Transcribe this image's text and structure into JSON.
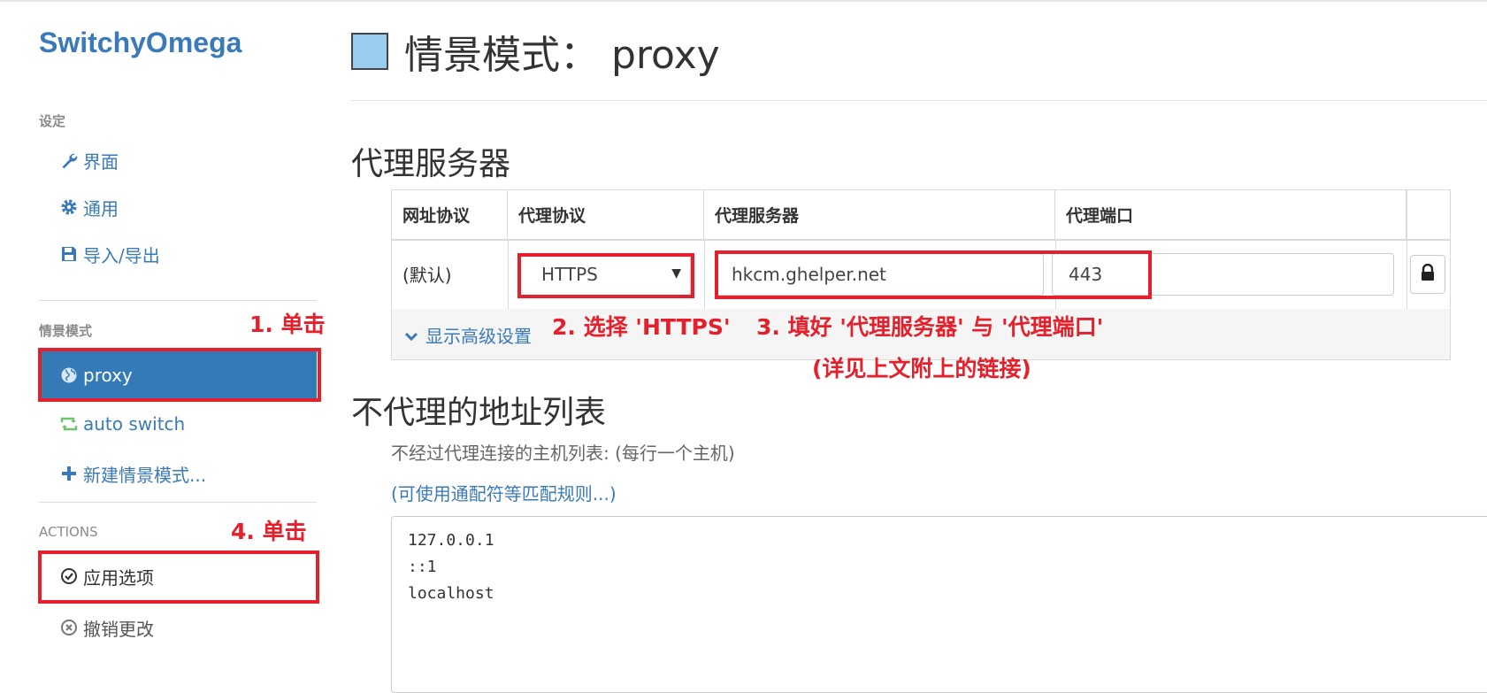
{
  "app": {
    "brand": "SwitchyOmega"
  },
  "sidebar": {
    "settings_heading": "设定",
    "settings_items": [
      {
        "label": "界面",
        "icon": "wrench-icon"
      },
      {
        "label": "通用",
        "icon": "gear-icon"
      },
      {
        "label": "导入/导出",
        "icon": "floppy-icon"
      }
    ],
    "profiles_heading": "情景模式",
    "profiles": [
      {
        "label": "proxy",
        "icon": "globe-icon",
        "active": true
      },
      {
        "label": "auto switch",
        "icon": "retweet-icon",
        "active": false
      },
      {
        "label": "新建情景模式...",
        "icon": "plus-icon",
        "active": false
      }
    ],
    "actions_heading": "ACTIONS",
    "actions": [
      {
        "label": "应用选项",
        "icon": "check-circle-icon"
      },
      {
        "label": "撤销更改",
        "icon": "x-circle-icon"
      }
    ]
  },
  "main": {
    "title": "情景模式： proxy",
    "title_color": "#99ccee",
    "proxy_section_heading": "代理服务器",
    "table": {
      "headers": [
        "网址协议",
        "代理协议",
        "代理服务器",
        "代理端口"
      ],
      "row": {
        "scheme": "(默认)",
        "protocol": "HTTPS",
        "server": "hkcm.ghelper.net",
        "port": "443"
      },
      "advanced_link": "显示高级设置"
    },
    "bypass_heading": "不代理的地址列表",
    "bypass_hint": "不经过代理连接的主机列表: (每行一个主机)",
    "bypass_rules_link": "(可使用通配符等匹配规则...)",
    "bypass_list": [
      "127.0.0.1",
      "::1",
      "localhost"
    ]
  },
  "annotations": {
    "step1": "1. 单击",
    "step2": "2. 选择 'HTTPS'",
    "step3": "3. 填好 '代理服务器' 与 '代理端口'",
    "step3_note": "(详见上文附上的链接)",
    "step4": "4. 单击",
    "color": "#e3202b"
  }
}
